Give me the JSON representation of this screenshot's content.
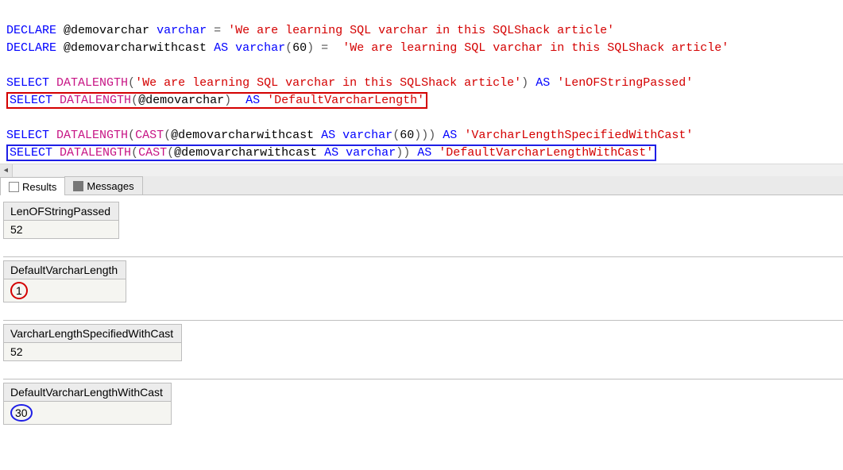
{
  "code": {
    "declare_kw": "DECLARE",
    "select_kw": "SELECT",
    "as_kw": "AS",
    "varchar_kw": "varchar",
    "datalength_fn": "DATALENGTH",
    "cast_fn": "CAST",
    "eq": " = ",
    "lp": "(",
    "rp": ")",
    "var1": "@demovarchar",
    "var2": "@demovarcharwithcast",
    "cast_len": "60",
    "str_lit": "'We are learning SQL varchar in this SQLShack article'",
    "alias1": "'LenOFStringPassed'",
    "alias2": "'DefaultVarcharLength'",
    "alias3": "'VarcharLengthSpecifiedWithCast'",
    "alias4": "'DefaultVarcharLengthWithCast'"
  },
  "tabs": {
    "results": "Results",
    "messages": "Messages"
  },
  "results": {
    "r1": {
      "header": "LenOFStringPassed",
      "value": "52"
    },
    "r2": {
      "header": "DefaultVarcharLength",
      "value": "1"
    },
    "r3": {
      "header": "VarcharLengthSpecifiedWithCast",
      "value": "52"
    },
    "r4": {
      "header": "DefaultVarcharLengthWithCast",
      "value": "30"
    }
  }
}
